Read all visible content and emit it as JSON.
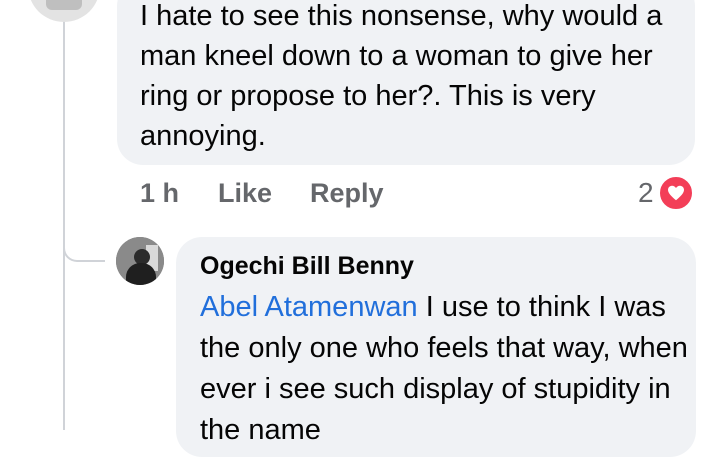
{
  "comment": {
    "text": "I hate to see this nonsense, why would a man kneel down to a woman to give her ring or propose to her?. This is very annoying.",
    "time": "1 h",
    "like_label": "Like",
    "reply_label": "Reply",
    "reaction_count": "2",
    "reaction_icon": "heart-icon"
  },
  "reply": {
    "author": "Ogechi Bill Benny",
    "mention": "Abel Atamenwan",
    "text": " I use to think I was the only one who feels that way, when ever i see such display of stupidity in the name"
  },
  "colors": {
    "bubble": "#f0f2f5",
    "mention": "#216fdb",
    "meta": "#65676b",
    "heart": "#f33e58"
  }
}
